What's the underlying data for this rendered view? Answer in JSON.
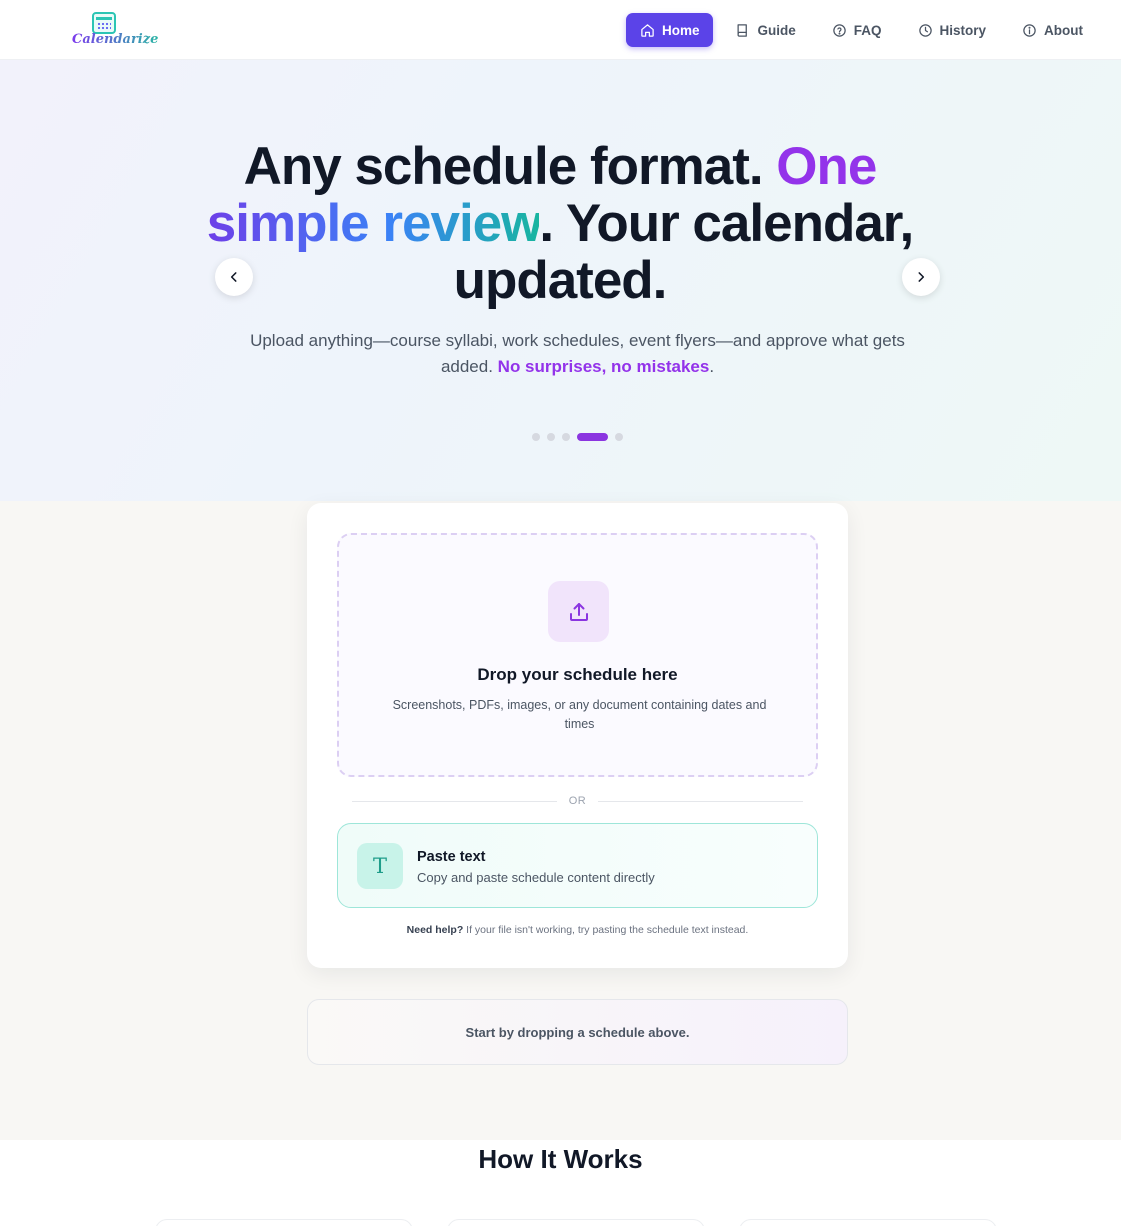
{
  "brand": {
    "logo_text": "Calendarize"
  },
  "nav": {
    "items": [
      {
        "label": "Home",
        "icon": "home-icon",
        "active": true
      },
      {
        "label": "Guide",
        "icon": "book-icon",
        "active": false
      },
      {
        "label": "FAQ",
        "icon": "help-circle-icon",
        "active": false
      },
      {
        "label": "History",
        "icon": "clock-icon",
        "active": false
      },
      {
        "label": "About",
        "icon": "info-icon",
        "active": false
      }
    ]
  },
  "hero": {
    "title_part1": "Any schedule format. ",
    "title_highlight1": "One",
    "title_highlight2": "simple review",
    "title_part2": ". Your calendar, updated.",
    "subtitle": "Upload anything—course syllabi, work schedules, event flyers—and approve what gets added. ",
    "subtitle_emphasis": "No surprises, no mistakes",
    "subtitle_end": ".",
    "carousel": {
      "slide_count": 5,
      "active_index": 3
    }
  },
  "upload": {
    "drop_title": "Drop your schedule here",
    "drop_description": "Screenshots, PDFs, images, or any document containing dates and times",
    "divider_text": "OR",
    "paste_icon_glyph": "T",
    "paste_title": "Paste text",
    "paste_description": "Copy and paste schedule content directly",
    "help_bold": "Need help?",
    "help_text": " If your file isn't working, try pasting the schedule text instead."
  },
  "status": {
    "message": "Start by dropping a schedule above."
  },
  "how_it_works": {
    "title": "How It Works"
  },
  "colors": {
    "primary": "#5b43e8",
    "accent_purple": "#9333ea",
    "accent_teal": "#18b5a0"
  }
}
